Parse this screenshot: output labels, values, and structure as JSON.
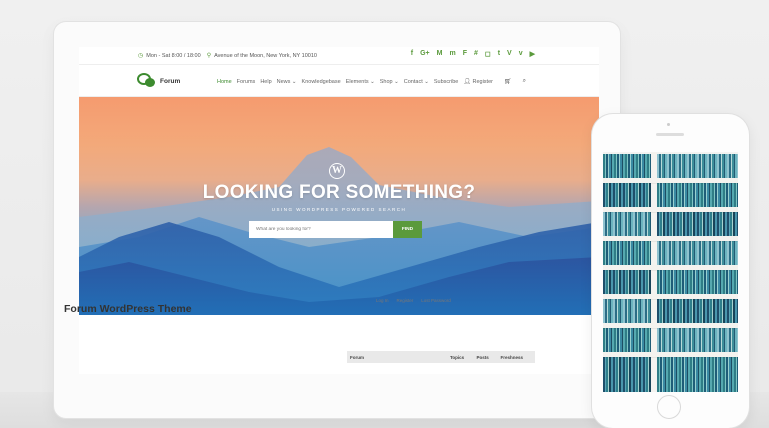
{
  "topbar": {
    "hours": "Mon - Sat 8:00 / 18:00",
    "address": "Avenue of the Moon, New York, NY 10010",
    "social_icons": [
      "facebook-icon",
      "google-plus-icon",
      "medium-icon",
      "meetup-icon",
      "foursquare-icon",
      "slack-icon",
      "chat-icon",
      "twitter-icon",
      "vine-icon",
      "vimeo-icon",
      "youtube-icon"
    ]
  },
  "logo": {
    "name": "Forum"
  },
  "nav": {
    "items": [
      "Home",
      "Forums",
      "Help",
      "News",
      "Knowledgebase",
      "Elements",
      "Shop",
      "Contact",
      "Subscribe",
      "Register"
    ],
    "dropdown_marker": "⌄"
  },
  "hero": {
    "logo_glyph": "W",
    "title": "LOOKING FOR SOMETHING?",
    "subtitle": "USING WORDPRESS POWERED SEARCH",
    "search_placeholder": "What are you looking for?",
    "search_button": "FIND"
  },
  "content": {
    "title": "Forum WordPress Theme",
    "links": [
      "Log In",
      "Register",
      "Lost Password"
    ],
    "table_headers": [
      "Forum",
      "Topics",
      "Posts",
      "Freshness"
    ]
  },
  "colors": {
    "accent": "#5b9a3c",
    "brand": "#3d8b2f"
  }
}
